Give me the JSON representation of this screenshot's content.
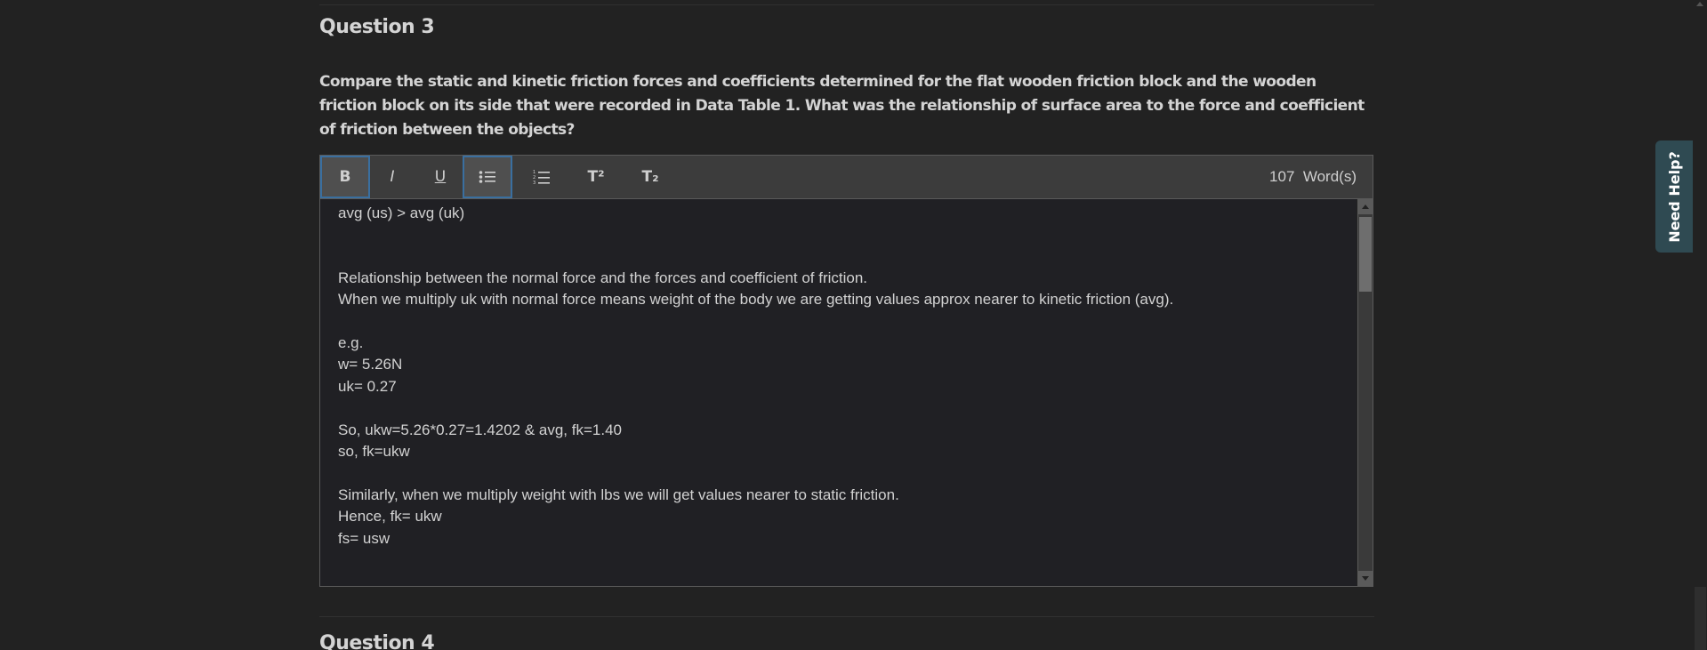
{
  "question3": {
    "title": "Question 3",
    "prompt": "Compare the static and kinetic friction forces and coefficients determined for the flat wooden friction block and the wooden friction block on its side that were recorded in Data Table 1. What was the relationship of surface area to the force and coefficient of friction between the objects?"
  },
  "toolbar": {
    "bold": "B",
    "italic": "I",
    "underline": "U",
    "superscript": "T²",
    "subscript": "T₂",
    "word_count": "107",
    "word_count_label": "Word(s)",
    "active_buttons": [
      "bold",
      "bullet-list"
    ]
  },
  "answer": {
    "lines": [
      "avg (us) > avg (uk)",
      "",
      "",
      "Relationship between the normal force and the forces and coefficient of friction.",
      "When we multiply uk with normal force means weight of the body we are getting values approx nearer to kinetic friction (avg).",
      "",
      "e.g.",
      "w= 5.26N",
      "uk= 0.27",
      "",
      "So, ukw=5.26*0.27=1.4202 & avg, fk=1.40",
      "so, fk=ukw",
      "",
      "Similarly, when we multiply weight with lbs we will get values nearer to static friction.",
      "Hence, fk= ukw",
      "fs= usw"
    ]
  },
  "question4": {
    "title": "Question 4"
  },
  "help_tab": {
    "label": "Need Help?",
    "color": "#2f4a52"
  }
}
